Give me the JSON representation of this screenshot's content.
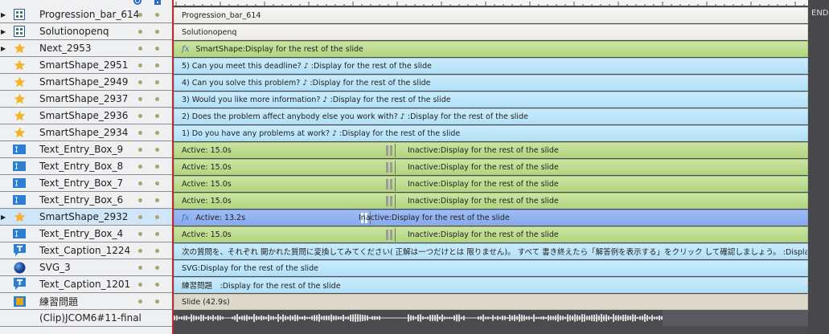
{
  "header": {
    "visibility_icon": "eye-icon",
    "lock_icon": "lock-icon"
  },
  "timeline": {
    "end_label": "END"
  },
  "layers": [
    {
      "name": "Progression_bar_614",
      "icon": "group-icon",
      "expand": true,
      "bar": {
        "style": "white",
        "text": "Progression_bar_614"
      }
    },
    {
      "name": "Solutionopenq",
      "icon": "group-icon",
      "expand": true,
      "bar": {
        "style": "white",
        "text": "Solutionopenq"
      }
    },
    {
      "name": "Next_2953",
      "icon": "star-icon",
      "expand": true,
      "bar": {
        "style": "green",
        "fx": true,
        "text": "SmartShape:Display for the rest of the slide"
      }
    },
    {
      "name": "SmartShape_2951",
      "icon": "star-icon",
      "bar": {
        "style": "blue",
        "text": "5) Can you meet this deadline? ♪ :Display for the rest of the slide"
      }
    },
    {
      "name": "SmartShape_2949",
      "icon": "star-icon",
      "bar": {
        "style": "blue",
        "text": "4) Can you solve this problem? ♪ :Display for the rest of the slide"
      }
    },
    {
      "name": "SmartShape_2937",
      "icon": "star-icon",
      "bar": {
        "style": "blue",
        "text": "3) Would you like more information? ♪ :Display for the rest of the slide"
      }
    },
    {
      "name": "SmartShape_2936",
      "icon": "star-icon",
      "bar": {
        "style": "blue",
        "text": "2) Does the problem affect anybody else you work with? ♪ :Display for the rest of the slide"
      }
    },
    {
      "name": "SmartShape_2934",
      "icon": "star-icon",
      "bar": {
        "style": "blue",
        "text": "1) Do you have any problems at work? ♪ :Display for the rest of the slide"
      }
    },
    {
      "name": "Text_Entry_Box_9",
      "icon": "text-entry-icon",
      "bar": {
        "style": "green",
        "text": "Active: 15.0s",
        "inactive": "Inactive:Display for the rest of the slide"
      }
    },
    {
      "name": "Text_Entry_Box_8",
      "icon": "text-entry-icon",
      "bar": {
        "style": "green",
        "text": "Active: 15.0s",
        "inactive": "Inactive:Display for the rest of the slide"
      }
    },
    {
      "name": "Text_Entry_Box_7",
      "icon": "text-entry-icon",
      "bar": {
        "style": "green",
        "text": "Active: 15.0s",
        "inactive": "Inactive:Display for the rest of the slide"
      }
    },
    {
      "name": "Text_Entry_Box_6",
      "icon": "text-entry-icon",
      "bar": {
        "style": "green",
        "text": "Active: 15.0s",
        "inactive": "Inactive:Display for the rest of the slide"
      }
    },
    {
      "name": "SmartShape_2932",
      "icon": "star-icon",
      "expand": true,
      "selected": true,
      "bar": {
        "style": "selb",
        "fx": true,
        "text": "Active: 13.2s",
        "inactive": "Inactive:Display for the rest of the slide"
      }
    },
    {
      "name": "Text_Entry_Box_4",
      "icon": "text-entry-icon",
      "bar": {
        "style": "green",
        "text": "Active: 15.0s",
        "inactive": "Inactive:Display for the rest of the slide"
      }
    },
    {
      "name": "Text_Caption_1224",
      "icon": "caption-icon",
      "bar": {
        "style": "blue",
        "text": "次の質問を、それぞれ 開かれた質問に変換してみてください( 正解は一つだけとは 限りません)。 すべて 書き終えたら「解答例を表示する」をクリック して確認しましょう。  :Display for the rest of the ..."
      }
    },
    {
      "name": "SVG_3",
      "icon": "svg-icon",
      "bar": {
        "style": "blue",
        "text": "SVG:Display for the rest of the slide"
      }
    },
    {
      "name": "Text_Caption_1201",
      "icon": "caption-icon",
      "bar": {
        "style": "blue",
        "text": "練習問題　:Display for the rest of the slide"
      }
    },
    {
      "name": "練習問題",
      "icon": "slide-icon",
      "bar": {
        "style": "slide",
        "text": "Slide (42.9s)"
      }
    },
    {
      "name": "(Clip)JCOM6#11-final.wav",
      "icon": "",
      "audio": true
    }
  ]
}
